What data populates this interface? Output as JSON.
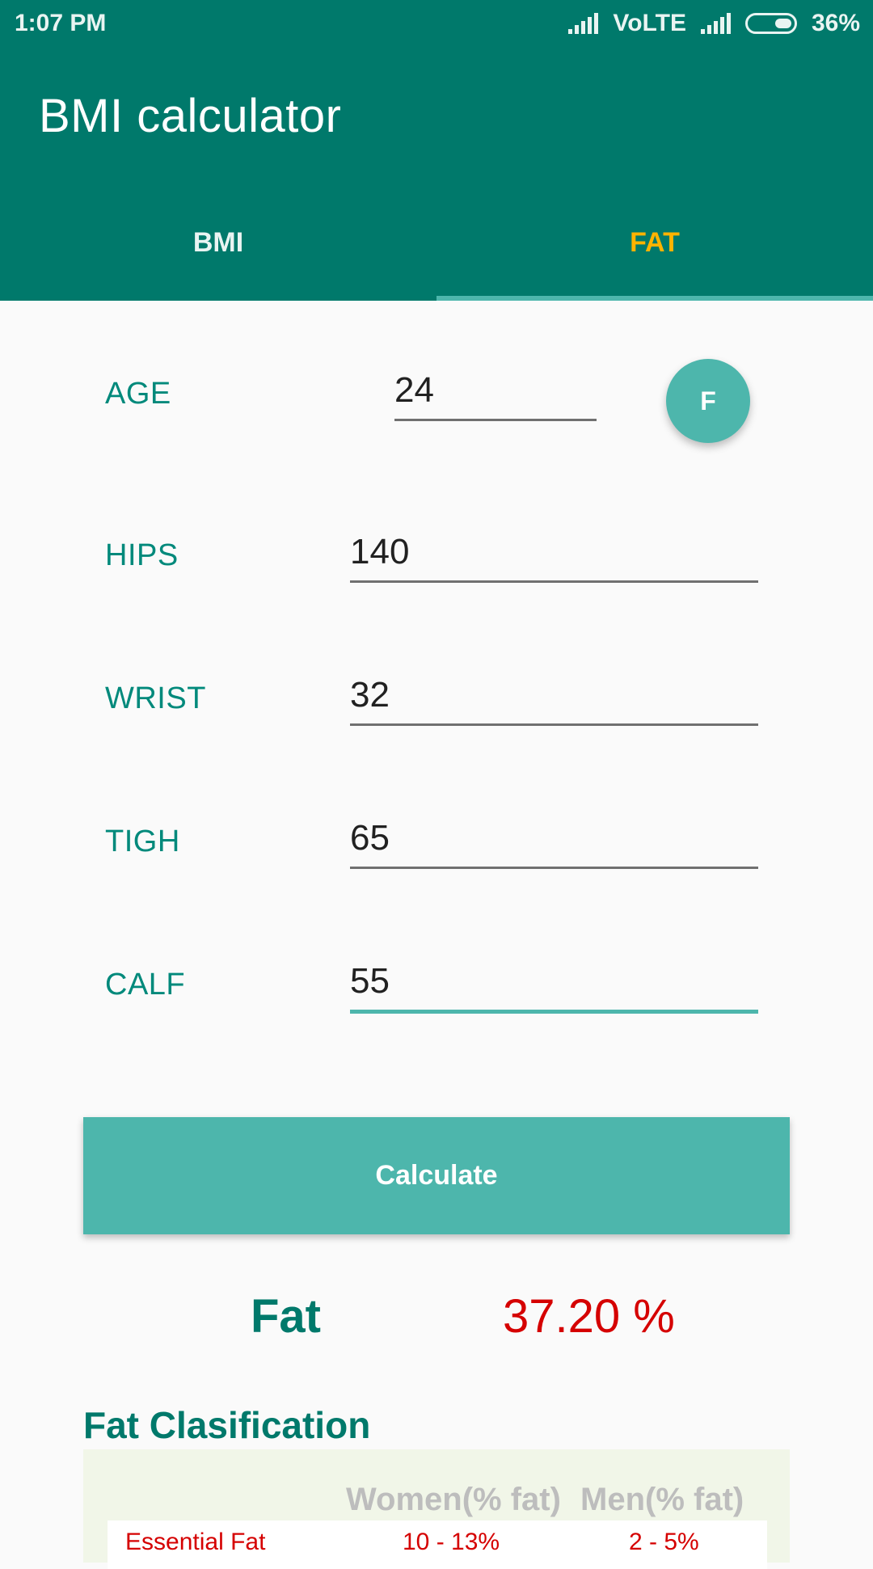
{
  "status_bar": {
    "time": "1:07 PM",
    "network": "VoLTE",
    "battery": "36%"
  },
  "app": {
    "title": "BMI calculator",
    "tabs": [
      {
        "label": "BMI",
        "active": false
      },
      {
        "label": "FAT",
        "active": true
      }
    ]
  },
  "form": {
    "gender_button": "F",
    "fields": [
      {
        "label": "AGE",
        "value": "24"
      },
      {
        "label": "HIPS",
        "value": "140"
      },
      {
        "label": "WRIST",
        "value": "32"
      },
      {
        "label": "TIGH",
        "value": "65"
      },
      {
        "label": "CALF",
        "value": "55"
      }
    ]
  },
  "actions": {
    "calculate_label": "Calculate"
  },
  "result": {
    "label": "Fat",
    "value": "37.20 %"
  },
  "classification": {
    "title": "Fat Clasification",
    "headers": {
      "women": "Women(% fat)",
      "men": "Men(% fat)"
    },
    "rows": [
      {
        "name": "Essential Fat",
        "women": "10 - 13%",
        "men": "2 - 5%"
      }
    ]
  },
  "colors": {
    "primary": "#00796b",
    "accent": "#4db6ac",
    "tab_active": "#ffb300",
    "result_value": "#d50000"
  },
  "icons": {
    "signal": "signal-icon",
    "battery": "battery-icon"
  }
}
